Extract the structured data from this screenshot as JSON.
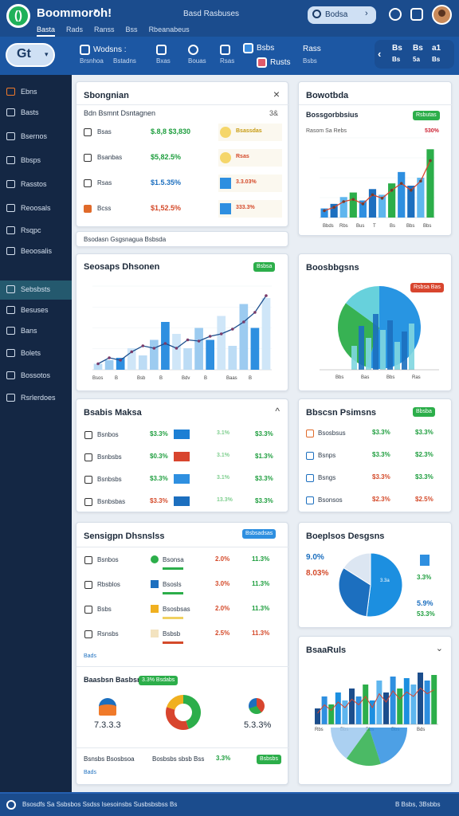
{
  "header": {
    "logo_glyph": "()",
    "title": "Boommoroh!",
    "nav_tabs": [
      "Basta",
      "Rads",
      "Ranss",
      "Bss",
      "Rbeanabeus"
    ],
    "center_title": "Basd Rasbuses",
    "search_value": "Bodsa",
    "icons": [
      "search-icon",
      "shield-icon",
      "chat-icon",
      "avatar"
    ]
  },
  "toolbar": {
    "primary_label": "Gt",
    "items": [
      {
        "label": "Wodsns :",
        "sub": "Brsnhoa"
      },
      {
        "label": "",
        "sub": "Bstadns"
      },
      {
        "label": "",
        "sub": "Bxas"
      },
      {
        "label": "",
        "sub": "Bouas"
      },
      {
        "label": "",
        "sub": "Rsas"
      },
      {
        "label": "Bsbs",
        "sub": "Bsbs"
      },
      {
        "label": "Rass",
        "sub": "Rusts"
      }
    ],
    "right_a": "Bs",
    "right_b": "Bs",
    "right_c": "a1",
    "right_d": "Bs",
    "right_e": "5a",
    "right_f": "Bs"
  },
  "sidebar": {
    "items": [
      "Ebns",
      "Basts",
      "Bsernos",
      "Bbsps",
      "Rasstos",
      "Reoosals",
      "Rsqpc",
      "Beoosalis",
      "Sebsbsts",
      "Besuses",
      "Bans",
      "Bolets",
      "Bossotos",
      "Rsrlerdoes"
    ],
    "active_index": 8
  },
  "overview": {
    "title": "Sbongnian",
    "close": "×",
    "subtitle": "Bdn Bsmnt Dsntagnen",
    "sub_right": "3&",
    "rows": [
      {
        "label": "Bsas",
        "value": "$.8,8 $3,830",
        "badge": "Bsassdas",
        "tag": ""
      },
      {
        "label": "Bsanbas",
        "value": "$5,82.5%",
        "badge": "Rsas",
        "tag": ""
      },
      {
        "label": "Rsas",
        "value": "$1.5.35%",
        "badge": "3.3.03%",
        "tag": ""
      },
      {
        "label": "Bcss",
        "value": "$1,52.5%",
        "badge": "333.3%",
        "tag": ""
      }
    ],
    "footer": "Bsodasn Gsgsnagua Bsbsda"
  },
  "revenue": {
    "title": "Bowotbda",
    "section": "Bossgorbbsius",
    "button": "Rsbutas",
    "label_left": "Rasom Sa Rebs",
    "label_right": "530%",
    "x_labels": [
      "Bbds",
      "Rbs",
      "Bus",
      "T",
      "Bs",
      "Bbs",
      "Bbs"
    ]
  },
  "sales": {
    "title": "Seosaps Dhsonen",
    "button": "Bsbsa",
    "x_labels": [
      "Bsos",
      "B",
      "Bsb",
      "B",
      "Bdv",
      "B",
      "Baas",
      "B"
    ]
  },
  "breakdown": {
    "title": "Boosbbgsns",
    "button": "Rsbsa Bas",
    "x_labels": [
      "Bbs",
      "Bas",
      "Bbs",
      "Ras"
    ]
  },
  "metrics": {
    "title": "Bsabis Maksa",
    "rows": [
      {
        "label": "Bsnbos",
        "v1": "$3.3%",
        "v2": "3.1%",
        "v3": "$3.3%"
      },
      {
        "label": "Bsnbsbs",
        "v1": "$0.3%",
        "v2": "3.1%",
        "v3": "$1.3%"
      },
      {
        "label": "Bsnbsbs",
        "v1": "$3.3%",
        "v2": "3.1%",
        "v3": "$3.3%"
      },
      {
        "label": "Bsnbsbas",
        "v1": "$3.3%",
        "v2": "13.3%",
        "v3": "$3.3%"
      }
    ]
  },
  "meta": {
    "title": "Bbscsn Psimsns",
    "button": "Bbsba",
    "rows": [
      {
        "label": "Bsosbsus",
        "v1": "$3.3%",
        "v2": "$3.3%"
      },
      {
        "label": "Bsnps",
        "v1": "$3.3%",
        "v2": "$2.3%"
      },
      {
        "label": "Bsngs",
        "v1": "$3.3%",
        "v2": "$3.3%"
      },
      {
        "label": "Bsonsos",
        "v1": "$2.3%",
        "v2": "$2.5%"
      }
    ]
  },
  "segments": {
    "title": "Sensigpn Dhsnslss",
    "button": "Bsbsadsas",
    "rows": [
      {
        "label": "Bsnbos",
        "mid": "Bsonsa",
        "v1": "2.0%",
        "v2": "11.3%"
      },
      {
        "label": "Rbsblos",
        "mid": "Bsosls",
        "v1": "3.0%",
        "v2": "11.3%"
      },
      {
        "label": "Bsbs",
        "mid": "Bsosbsas",
        "v1": "2.0%",
        "v2": "11.3%"
      },
      {
        "label": "Rsnsbs",
        "mid": "Bsbsb",
        "v1": "2.5%",
        "v2": "11.3%"
      }
    ],
    "link": "Bads",
    "summary_title": "Baasbsn Basbsn",
    "summary_badge": "3.3% Bsdabs",
    "stat_a": "7.3.3.3",
    "stat_b": "5.3.3%",
    "footer_left": "Bsnsbs Bsosbsoa",
    "footer_mid": "Bosbsbs sbsb Bss",
    "footer_val": "3.3%",
    "footer_button": "Bsbsbs",
    "footer_link": "Bads"
  },
  "devices": {
    "title": "Boeplsos Desgsns",
    "pct_a": "9.0%",
    "pct_b": "8.03%",
    "pct_c": "3.3%",
    "pct_d": "5.9%",
    "pct_e": "53.3%",
    "pie_label": "3.3a"
  },
  "trend": {
    "title": "BsaaRuls",
    "x_labels": [
      "Rbs",
      "Bbs",
      "Bbs",
      "Bbs",
      "Bds"
    ]
  },
  "footer": {
    "left": "Bsosdfs Sa Ssbsbos Ssdss Isesoinsbs Susbsbsbss Bs",
    "right": "B Bsbs, 3Bsbbs"
  },
  "chart_data": [
    {
      "type": "bar",
      "title": "Bossgorbbsius",
      "categories": [
        "1",
        "2",
        "3",
        "4",
        "5",
        "6",
        "7",
        "8",
        "9",
        "10",
        "11",
        "12"
      ],
      "series": [
        {
          "values": [
            8,
            12,
            18,
            22,
            15,
            25,
            20,
            30,
            40,
            28,
            35,
            60
          ]
        },
        {
          "values": [
            6,
            9,
            14,
            16,
            12,
            20,
            17,
            24,
            30,
            24,
            32,
            50
          ]
        }
      ],
      "ylim": [
        0,
        70
      ]
    },
    {
      "type": "bar",
      "title": "Seosaps Dhsonen",
      "categories": [
        "1",
        "2",
        "3",
        "4",
        "5",
        "6",
        "7",
        "8",
        "9",
        "10",
        "11",
        "12",
        "13",
        "14",
        "15",
        "16"
      ],
      "series": [
        {
          "values": [
            5,
            8,
            10,
            18,
            12,
            25,
            40,
            30,
            18,
            35,
            25,
            45,
            20,
            55,
            35,
            60
          ]
        },
        {
          "values": [
            5,
            10,
            8,
            15,
            20,
            18,
            22,
            18,
            25,
            24,
            28,
            30,
            34,
            40,
            48,
            62
          ]
        }
      ],
      "ylim": [
        0,
        70
      ]
    },
    {
      "type": "pie",
      "title": "Boosbbgsns",
      "values": [
        55,
        30,
        15
      ]
    },
    {
      "type": "pie",
      "title": "Boeplsos Desgsns",
      "values": [
        52,
        32,
        16
      ]
    },
    {
      "type": "bar",
      "title": "BsaaRuls",
      "categories": [
        "1",
        "2",
        "3",
        "4",
        "5",
        "6",
        "7",
        "8",
        "9",
        "10",
        "11",
        "12",
        "13",
        "14",
        "15",
        "16",
        "17",
        "18"
      ],
      "series": [
        {
          "values": [
            20,
            35,
            25,
            40,
            30,
            45,
            35,
            50,
            30,
            55,
            40,
            60,
            45,
            58,
            50,
            65,
            55,
            62
          ]
        }
      ],
      "ylim": [
        0,
        70
      ]
    }
  ]
}
